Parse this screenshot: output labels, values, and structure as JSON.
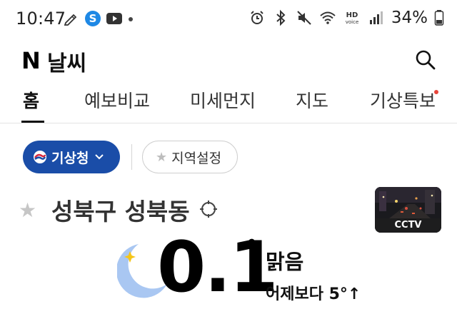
{
  "status_bar": {
    "time": "10:47",
    "battery": "34%",
    "left_icons": [
      "pen-icon",
      "app-s-icon",
      "youtube-icon",
      "dot-icon"
    ],
    "right_icons": [
      "alarm-icon",
      "bluetooth-icon",
      "mute-icon",
      "wifi-icon",
      "hd-voice-icon",
      "signal-icon",
      "battery-icon"
    ]
  },
  "header": {
    "logo": "N",
    "title": "날씨"
  },
  "tabs": [
    {
      "label": "홈",
      "active": true
    },
    {
      "label": "예보비교",
      "active": false
    },
    {
      "label": "미세먼지",
      "active": false
    },
    {
      "label": "지도",
      "active": false
    },
    {
      "label": "기상특보",
      "active": false,
      "badge": true
    }
  ],
  "source": {
    "provider_label": "기상청",
    "region_label": "지역설정"
  },
  "location": {
    "name": "성북구 성북동"
  },
  "cctv": {
    "label": "CCTV"
  },
  "current": {
    "temperature": "0.1",
    "degree_symbol": "°",
    "condition": "맑음",
    "compare_text": "어제보다 5°↑"
  },
  "colors": {
    "accent": "#1a4da8",
    "badge": "#e8443a",
    "moon": "#a9c7f2",
    "sparkle": "#f5c518"
  }
}
